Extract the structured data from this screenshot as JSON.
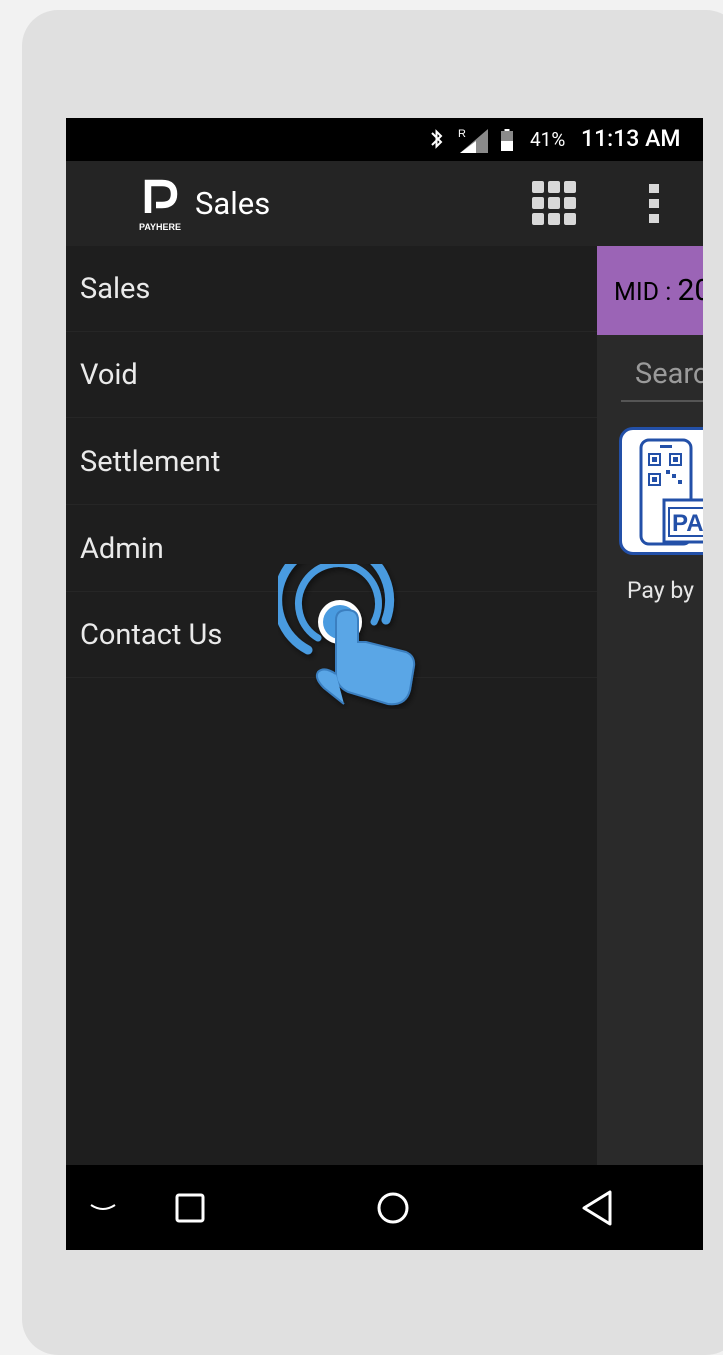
{
  "status_bar": {
    "battery_percent": "41%",
    "time": "11:13 AM",
    "icons": [
      "bluetooth-icon",
      "signal-roaming-icon",
      "battery-icon"
    ]
  },
  "toolbar": {
    "logo_text": "PAYHERE",
    "title": "Sales",
    "icons": [
      "grid-menu-icon",
      "more-vert-icon"
    ]
  },
  "drawer": {
    "items": [
      {
        "label": "Sales"
      },
      {
        "label": "Void"
      },
      {
        "label": "Settlement"
      },
      {
        "label": "Admin"
      },
      {
        "label": "Contact Us"
      }
    ]
  },
  "content": {
    "mid_label": "MID :",
    "mid_value": "20",
    "search_placeholder": "Searc",
    "card": {
      "badge_text": "PA",
      "label": "Pay by"
    }
  },
  "nav_bar": {
    "icons": [
      "keyboard-hide-icon",
      "recents-square-icon",
      "home-circle-icon",
      "back-triangle-icon"
    ]
  },
  "colors": {
    "accent_purple": "#9b64b6",
    "card_border": "#2350a8",
    "tap_hint": "#4a9be0"
  }
}
